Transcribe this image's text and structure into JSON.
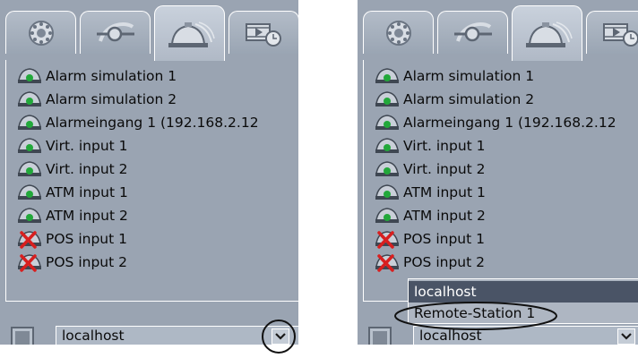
{
  "inputs": [
    {
      "label": "Alarm simulation 1",
      "status": "ok"
    },
    {
      "label": "Alarm simulation 2",
      "status": "ok"
    },
    {
      "label": "Alarmeingang 1 (192.168.2.12",
      "status": "ok"
    },
    {
      "label": "Virt. input 1",
      "status": "ok"
    },
    {
      "label": "Virt. input 2",
      "status": "ok"
    },
    {
      "label": "ATM input 1",
      "status": "ok"
    },
    {
      "label": "ATM input 2",
      "status": "ok"
    },
    {
      "label": "POS input 1",
      "status": "error"
    },
    {
      "label": "POS input 2",
      "status": "error"
    }
  ],
  "station_selector": {
    "selected": "localhost",
    "options": [
      "localhost",
      "Remote-Station 1"
    ]
  },
  "tab_icons": [
    "dial-icon",
    "connect-icon",
    "alarm-light-icon",
    "timed-video-icon"
  ],
  "active_tab": 2,
  "colors": {
    "panel": "#9aa4b2",
    "status_ok": "#22a83a",
    "status_error": "#d81f1f",
    "highlight": "#4a5466"
  }
}
